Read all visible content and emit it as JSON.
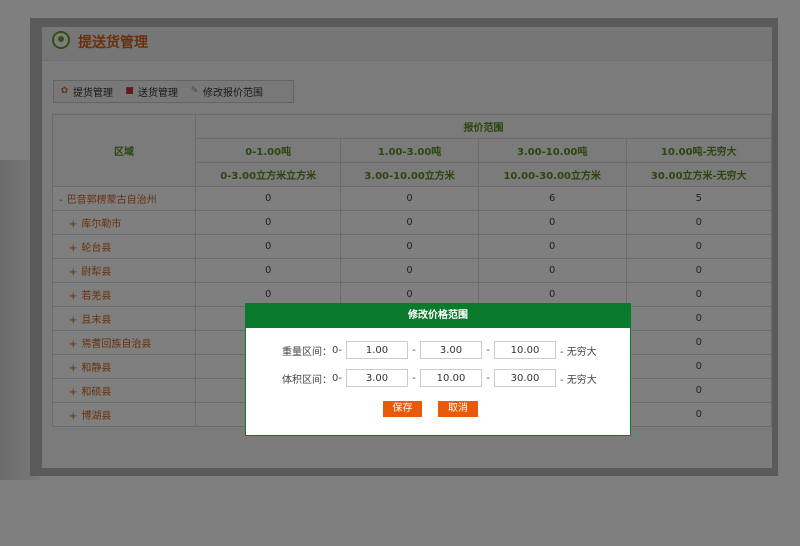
{
  "header": {
    "title": "提送货管理"
  },
  "tabs": [
    {
      "label": "提货管理",
      "icon": "gear-icon"
    },
    {
      "label": "送货管理",
      "icon": "truck-icon"
    },
    {
      "label": "修改报价范围",
      "icon": "edit-icon"
    }
  ],
  "table": {
    "area_header": "区域",
    "range_header": "报价范围",
    "columns": [
      {
        "weight": "0-1.00吨",
        "volume": "0-3.00立方米立方米"
      },
      {
        "weight": "1.00-3.00吨",
        "volume": "3.00-10.00立方米"
      },
      {
        "weight": "3.00-10.00吨",
        "volume": "10.00-30.00立方米"
      },
      {
        "weight": "10.00吨-无穷大",
        "volume": "30.00立方米-无穷大"
      }
    ],
    "rows": [
      {
        "prefix": "-",
        "name": "巴音郭楞蒙古自治州",
        "values": [
          "0",
          "0",
          "6",
          "5"
        ]
      },
      {
        "prefix": "+",
        "name": "库尔勒市",
        "values": [
          "0",
          "0",
          "0",
          "0"
        ]
      },
      {
        "prefix": "+",
        "name": "轮台县",
        "values": [
          "0",
          "0",
          "0",
          "0"
        ]
      },
      {
        "prefix": "+",
        "name": "尉犁县",
        "values": [
          "0",
          "0",
          "0",
          "0"
        ]
      },
      {
        "prefix": "+",
        "name": "若羌县",
        "values": [
          "0",
          "0",
          "0",
          "0"
        ]
      },
      {
        "prefix": "+",
        "name": "且末县",
        "values": [
          "",
          "",
          "",
          "0"
        ]
      },
      {
        "prefix": "+",
        "name": "焉耆回族自治县",
        "values": [
          "",
          "",
          "",
          "0"
        ]
      },
      {
        "prefix": "+",
        "name": "和静县",
        "values": [
          "",
          "",
          "",
          "0"
        ]
      },
      {
        "prefix": "+",
        "name": "和硕县",
        "values": [
          "",
          "",
          "",
          "0"
        ]
      },
      {
        "prefix": "+",
        "name": "博湖县",
        "values": [
          "",
          "",
          "",
          "0"
        ]
      }
    ]
  },
  "dialog": {
    "title": "修改价格范围",
    "weight": {
      "label": "重量区间：",
      "start": "0-",
      "values": [
        "1.00",
        "3.00",
        "10.00"
      ],
      "end": "- 无穷大"
    },
    "volume": {
      "label": "体积区间：",
      "start": "0-",
      "values": [
        "3.00",
        "10.00",
        "30.00"
      ],
      "end": "- 无穷大"
    },
    "separator": "-",
    "save_label": "保存",
    "cancel_label": "取消"
  }
}
